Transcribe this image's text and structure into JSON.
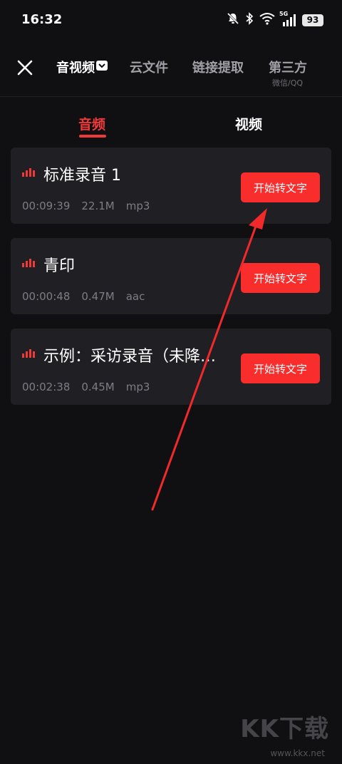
{
  "status_bar": {
    "time": "16:32",
    "network": "5G",
    "battery": "93"
  },
  "topnav": {
    "tabs": [
      {
        "label": "音视频",
        "active": true
      },
      {
        "label": "云文件",
        "active": false
      },
      {
        "label": "链接提取",
        "active": false
      },
      {
        "label": "第三方",
        "active": false
      }
    ],
    "third_party_sub": "微信/QQ"
  },
  "subtabs": [
    {
      "label": "音频",
      "active": true
    },
    {
      "label": "视频",
      "active": false
    }
  ],
  "files": [
    {
      "title": "标准录音 1",
      "duration": "00:09:39",
      "size": "22.1M",
      "format": "mp3",
      "button": "开始转文字"
    },
    {
      "title": "青印",
      "duration": "00:00:48",
      "size": "0.47M",
      "format": "aac",
      "button": "开始转文字"
    },
    {
      "title": "示例：采访录音（未降…",
      "duration": "00:02:38",
      "size": "0.45M",
      "format": "mp3",
      "button": "开始转文字"
    }
  ],
  "watermark": {
    "logo": "KK下载",
    "url": "www.kkx.net"
  },
  "colors": {
    "background": "#101013",
    "card": "#1f1f24",
    "accent": "#fa2d2d",
    "active_tab": "#f03a3a",
    "meta_text": "#7d7d84"
  }
}
